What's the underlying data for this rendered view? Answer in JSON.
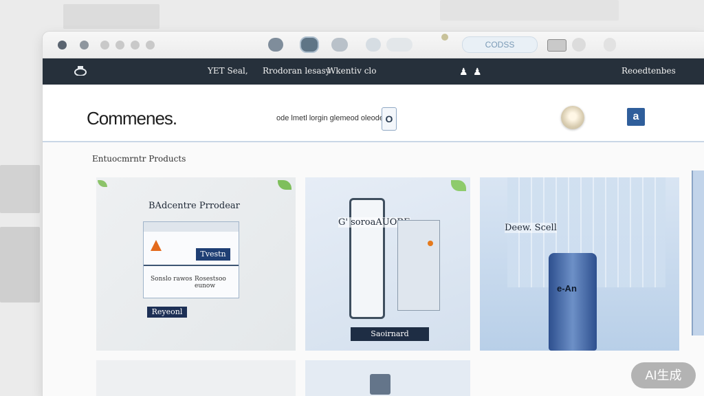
{
  "window": {
    "address_text": "CODSS"
  },
  "navbar": {
    "links": [
      "YET Seal,",
      "Rrodoran lesasy",
      "Wkentiv clo"
    ],
    "right_text": "Reoedtenbes"
  },
  "header": {
    "brand": "Commenes.",
    "search_text": "ode lmetl lorgin glemeod oleode",
    "search_button": "O",
    "account_button": "a"
  },
  "section": {
    "title": "Entuocmrntr Products"
  },
  "cards": [
    {
      "title": "BAdcentre Prrodear",
      "panel_button": "Tvestn",
      "panel_text_left": "Sonslo rawos",
      "panel_text_right": "Rosestsoo eunow",
      "action_button": "Reyeonl"
    },
    {
      "title": "G' soroaAUORE",
      "action_button": "Saoirnard"
    },
    {
      "title": "Deew. Scell",
      "label": "e-An"
    }
  ],
  "watermark": "AI生成",
  "colors": {
    "navbar": "#26303b",
    "accent": "#1f3f74",
    "brand_blue": "#2f5e9b"
  }
}
